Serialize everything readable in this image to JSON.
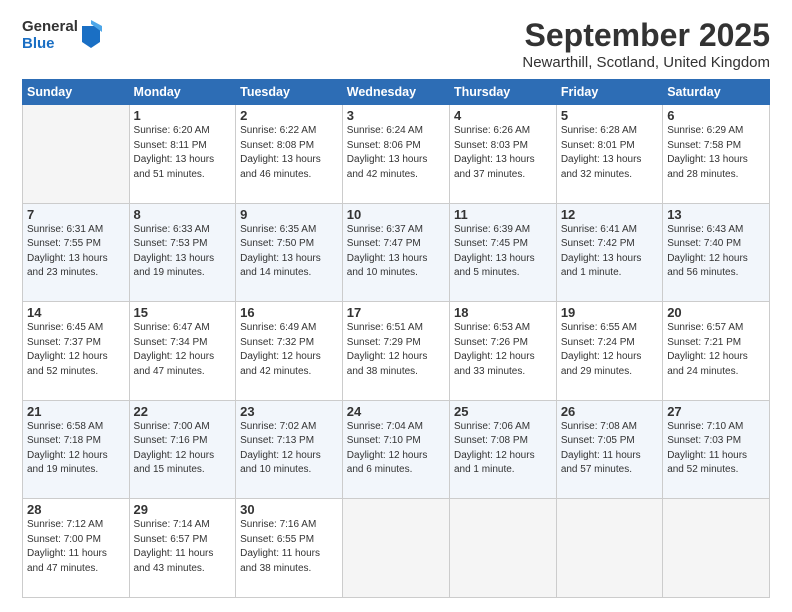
{
  "logo": {
    "general": "General",
    "blue": "Blue"
  },
  "header": {
    "month": "September 2025",
    "location": "Newarthill, Scotland, United Kingdom"
  },
  "weekdays": [
    "Sunday",
    "Monday",
    "Tuesday",
    "Wednesday",
    "Thursday",
    "Friday",
    "Saturday"
  ],
  "weeks": [
    [
      {
        "day": "",
        "sunrise": "",
        "sunset": "",
        "daylight": ""
      },
      {
        "day": "1",
        "sunrise": "Sunrise: 6:20 AM",
        "sunset": "Sunset: 8:11 PM",
        "daylight": "Daylight: 13 hours and 51 minutes."
      },
      {
        "day": "2",
        "sunrise": "Sunrise: 6:22 AM",
        "sunset": "Sunset: 8:08 PM",
        "daylight": "Daylight: 13 hours and 46 minutes."
      },
      {
        "day": "3",
        "sunrise": "Sunrise: 6:24 AM",
        "sunset": "Sunset: 8:06 PM",
        "daylight": "Daylight: 13 hours and 42 minutes."
      },
      {
        "day": "4",
        "sunrise": "Sunrise: 6:26 AM",
        "sunset": "Sunset: 8:03 PM",
        "daylight": "Daylight: 13 hours and 37 minutes."
      },
      {
        "day": "5",
        "sunrise": "Sunrise: 6:28 AM",
        "sunset": "Sunset: 8:01 PM",
        "daylight": "Daylight: 13 hours and 32 minutes."
      },
      {
        "day": "6",
        "sunrise": "Sunrise: 6:29 AM",
        "sunset": "Sunset: 7:58 PM",
        "daylight": "Daylight: 13 hours and 28 minutes."
      }
    ],
    [
      {
        "day": "7",
        "sunrise": "Sunrise: 6:31 AM",
        "sunset": "Sunset: 7:55 PM",
        "daylight": "Daylight: 13 hours and 23 minutes."
      },
      {
        "day": "8",
        "sunrise": "Sunrise: 6:33 AM",
        "sunset": "Sunset: 7:53 PM",
        "daylight": "Daylight: 13 hours and 19 minutes."
      },
      {
        "day": "9",
        "sunrise": "Sunrise: 6:35 AM",
        "sunset": "Sunset: 7:50 PM",
        "daylight": "Daylight: 13 hours and 14 minutes."
      },
      {
        "day": "10",
        "sunrise": "Sunrise: 6:37 AM",
        "sunset": "Sunset: 7:47 PM",
        "daylight": "Daylight: 13 hours and 10 minutes."
      },
      {
        "day": "11",
        "sunrise": "Sunrise: 6:39 AM",
        "sunset": "Sunset: 7:45 PM",
        "daylight": "Daylight: 13 hours and 5 minutes."
      },
      {
        "day": "12",
        "sunrise": "Sunrise: 6:41 AM",
        "sunset": "Sunset: 7:42 PM",
        "daylight": "Daylight: 13 hours and 1 minute."
      },
      {
        "day": "13",
        "sunrise": "Sunrise: 6:43 AM",
        "sunset": "Sunset: 7:40 PM",
        "daylight": "Daylight: 12 hours and 56 minutes."
      }
    ],
    [
      {
        "day": "14",
        "sunrise": "Sunrise: 6:45 AM",
        "sunset": "Sunset: 7:37 PM",
        "daylight": "Daylight: 12 hours and 52 minutes."
      },
      {
        "day": "15",
        "sunrise": "Sunrise: 6:47 AM",
        "sunset": "Sunset: 7:34 PM",
        "daylight": "Daylight: 12 hours and 47 minutes."
      },
      {
        "day": "16",
        "sunrise": "Sunrise: 6:49 AM",
        "sunset": "Sunset: 7:32 PM",
        "daylight": "Daylight: 12 hours and 42 minutes."
      },
      {
        "day": "17",
        "sunrise": "Sunrise: 6:51 AM",
        "sunset": "Sunset: 7:29 PM",
        "daylight": "Daylight: 12 hours and 38 minutes."
      },
      {
        "day": "18",
        "sunrise": "Sunrise: 6:53 AM",
        "sunset": "Sunset: 7:26 PM",
        "daylight": "Daylight: 12 hours and 33 minutes."
      },
      {
        "day": "19",
        "sunrise": "Sunrise: 6:55 AM",
        "sunset": "Sunset: 7:24 PM",
        "daylight": "Daylight: 12 hours and 29 minutes."
      },
      {
        "day": "20",
        "sunrise": "Sunrise: 6:57 AM",
        "sunset": "Sunset: 7:21 PM",
        "daylight": "Daylight: 12 hours and 24 minutes."
      }
    ],
    [
      {
        "day": "21",
        "sunrise": "Sunrise: 6:58 AM",
        "sunset": "Sunset: 7:18 PM",
        "daylight": "Daylight: 12 hours and 19 minutes."
      },
      {
        "day": "22",
        "sunrise": "Sunrise: 7:00 AM",
        "sunset": "Sunset: 7:16 PM",
        "daylight": "Daylight: 12 hours and 15 minutes."
      },
      {
        "day": "23",
        "sunrise": "Sunrise: 7:02 AM",
        "sunset": "Sunset: 7:13 PM",
        "daylight": "Daylight: 12 hours and 10 minutes."
      },
      {
        "day": "24",
        "sunrise": "Sunrise: 7:04 AM",
        "sunset": "Sunset: 7:10 PM",
        "daylight": "Daylight: 12 hours and 6 minutes."
      },
      {
        "day": "25",
        "sunrise": "Sunrise: 7:06 AM",
        "sunset": "Sunset: 7:08 PM",
        "daylight": "Daylight: 12 hours and 1 minute."
      },
      {
        "day": "26",
        "sunrise": "Sunrise: 7:08 AM",
        "sunset": "Sunset: 7:05 PM",
        "daylight": "Daylight: 11 hours and 57 minutes."
      },
      {
        "day": "27",
        "sunrise": "Sunrise: 7:10 AM",
        "sunset": "Sunset: 7:03 PM",
        "daylight": "Daylight: 11 hours and 52 minutes."
      }
    ],
    [
      {
        "day": "28",
        "sunrise": "Sunrise: 7:12 AM",
        "sunset": "Sunset: 7:00 PM",
        "daylight": "Daylight: 11 hours and 47 minutes."
      },
      {
        "day": "29",
        "sunrise": "Sunrise: 7:14 AM",
        "sunset": "Sunset: 6:57 PM",
        "daylight": "Daylight: 11 hours and 43 minutes."
      },
      {
        "day": "30",
        "sunrise": "Sunrise: 7:16 AM",
        "sunset": "Sunset: 6:55 PM",
        "daylight": "Daylight: 11 hours and 38 minutes."
      },
      {
        "day": "",
        "sunrise": "",
        "sunset": "",
        "daylight": ""
      },
      {
        "day": "",
        "sunrise": "",
        "sunset": "",
        "daylight": ""
      },
      {
        "day": "",
        "sunrise": "",
        "sunset": "",
        "daylight": ""
      },
      {
        "day": "",
        "sunrise": "",
        "sunset": "",
        "daylight": ""
      }
    ]
  ]
}
